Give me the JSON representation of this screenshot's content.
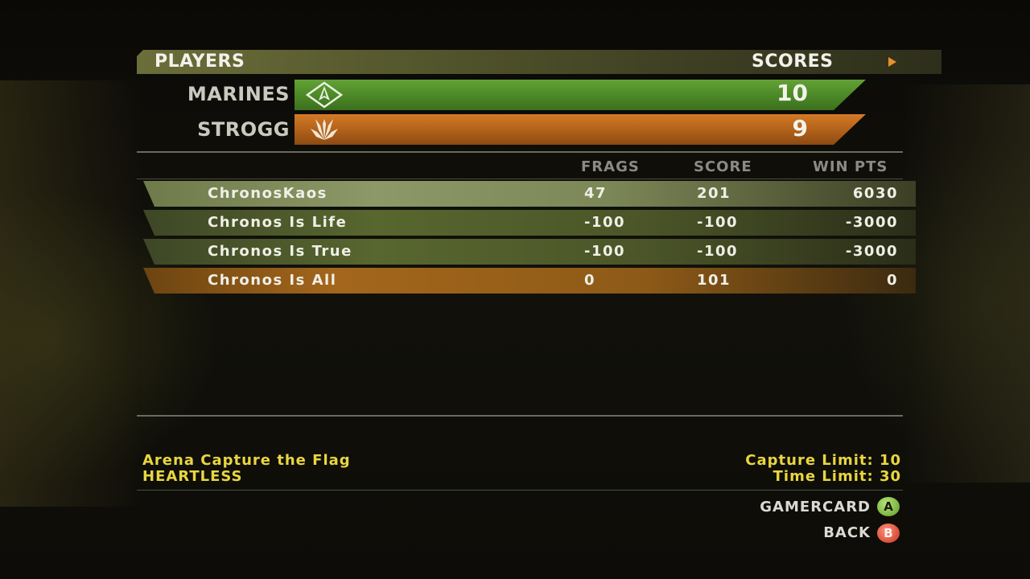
{
  "header": {
    "players_label": "PLAYERS",
    "scores_label": "SCORES"
  },
  "teams": [
    {
      "name": "MARINES",
      "score": "10",
      "color": "#4f8a2a",
      "icon": "marines-emblem-icon"
    },
    {
      "name": "STROGG",
      "score": "9",
      "color": "#b8631b",
      "icon": "strogg-emblem-icon"
    }
  ],
  "columns": {
    "frags": "FRAGS",
    "score": "SCORE",
    "win_pts": "WIN PTS"
  },
  "players": [
    {
      "name": "ChronosKaos",
      "frags": "47",
      "score": "201",
      "win_pts": "6030",
      "team": "MARINES"
    },
    {
      "name": "Chronos Is Life",
      "frags": "-100",
      "score": "-100",
      "win_pts": "-3000",
      "team": "MARINES"
    },
    {
      "name": "Chronos Is True",
      "frags": "-100",
      "score": "-100",
      "win_pts": "-3000",
      "team": "MARINES"
    },
    {
      "name": "Chronos Is All",
      "frags": "0",
      "score": "101",
      "win_pts": "0",
      "team": "STROGG"
    }
  ],
  "match": {
    "mode": "Arena Capture the Flag",
    "map": "HEARTLESS",
    "capture_limit": "Capture Limit: 10",
    "time_limit": "Time Limit: 30"
  },
  "prompts": {
    "gamercard": "GAMERCARD",
    "gamercard_button": "A",
    "back": "BACK",
    "back_button": "B"
  }
}
